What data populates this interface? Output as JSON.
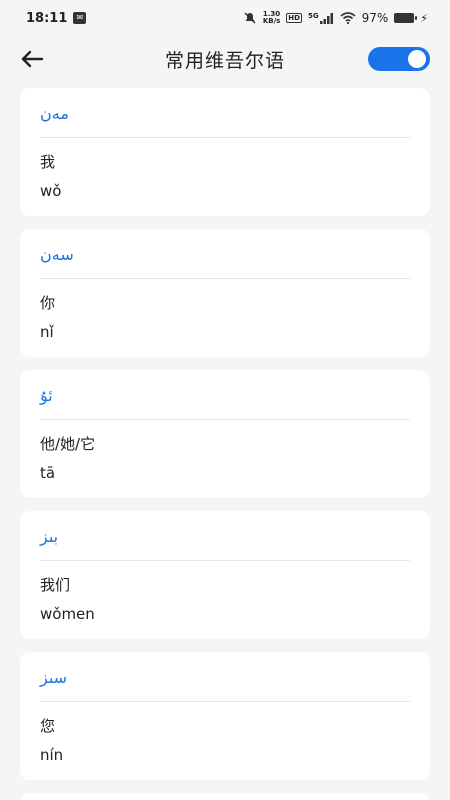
{
  "status_bar": {
    "time": "18:11",
    "speed_value": "1.30",
    "speed_unit": "KB/s",
    "hd": "HD",
    "network": "5G",
    "battery": "97%"
  },
  "header": {
    "title": "常用维吾尔语",
    "toggle_on": true
  },
  "colors": {
    "accent": "#1a73e8",
    "background": "#f4f5f7",
    "card": "#ffffff"
  },
  "cards": [
    {
      "uyghur": "مەن",
      "chinese": "我",
      "pinyin": "wǒ"
    },
    {
      "uyghur": "سەن",
      "chinese": "你",
      "pinyin": "nǐ"
    },
    {
      "uyghur": "ئۇ",
      "chinese": "他/她/它",
      "pinyin": "tā"
    },
    {
      "uyghur": "بىز",
      "chinese": "我们",
      "pinyin": "wǒmen"
    },
    {
      "uyghur": "سىز",
      "chinese": "您",
      "pinyin": "nín"
    }
  ]
}
